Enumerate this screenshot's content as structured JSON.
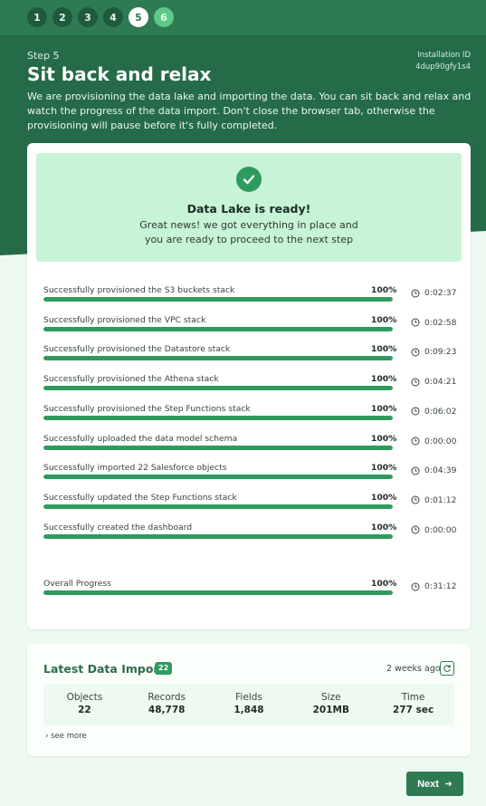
{
  "steps": [
    {
      "label": "1",
      "state": "done"
    },
    {
      "label": "2",
      "state": "done"
    },
    {
      "label": "3",
      "state": "done"
    },
    {
      "label": "4",
      "state": "done"
    },
    {
      "label": "5",
      "state": "active"
    },
    {
      "label": "6",
      "state": "future"
    }
  ],
  "header": {
    "step_label": "Step 5",
    "title": "Sit back and relax",
    "installation_label": "Installation ID",
    "installation_id": "4dup90gfy1s4",
    "description": "We are provisioning the data lake and importing the data. You can sit back and relax and watch the progress of the data import. Don't close the browser tab, otherwise the provisioning will pause before it's fully completed."
  },
  "ready": {
    "icon": "check-circle-icon",
    "title": "Data Lake is ready!",
    "text": "Great news! we got everything in place and you are ready to proceed to the next step"
  },
  "progress": [
    {
      "label": "Successfully provisioned the S3 buckets stack",
      "percent": "100%",
      "value": 1.0,
      "time": "0:02:37"
    },
    {
      "label": "Successfully provisioned the VPC stack",
      "percent": "100%",
      "value": 1.0,
      "time": "0:02:58"
    },
    {
      "label": "Successfully provisioned the Datastore stack",
      "percent": "100%",
      "value": 1.0,
      "time": "0:09:23"
    },
    {
      "label": "Successfully provisioned the Athena stack",
      "percent": "100%",
      "value": 1.0,
      "time": "0:04:21"
    },
    {
      "label": "Successfully provisioned the Step Functions stack",
      "percent": "100%",
      "value": 1.0,
      "time": "0:06:02"
    },
    {
      "label": "Successfully uploaded the data model schema",
      "percent": "100%",
      "value": 1.0,
      "time": "0:00:00"
    },
    {
      "label": "Successfully imported 22 Salesforce objects",
      "percent": "100%",
      "value": 1.0,
      "time": "0:04:39"
    },
    {
      "label": "Successfully updated the Step Functions stack",
      "percent": "100%",
      "value": 1.0,
      "time": "0:01:12"
    },
    {
      "label": "Successfully created the dashboard",
      "percent": "100%",
      "value": 1.0,
      "time": "0:00:00"
    }
  ],
  "overall": {
    "label": "Overall Progress",
    "percent": "100%",
    "value": 1.0,
    "time": "0:31:12"
  },
  "latest_import": {
    "title": "Latest Data Import",
    "badge": "22",
    "ago": "2 weeks ago",
    "stats": [
      {
        "label": "Objects",
        "value": "22"
      },
      {
        "label": "Records",
        "value": "48,778"
      },
      {
        "label": "Fields",
        "value": "1,848"
      },
      {
        "label": "Size",
        "value": "201MB"
      },
      {
        "label": "Time",
        "value": "277 sec"
      }
    ],
    "see_more": "see more"
  },
  "next_button": "Next",
  "colors": {
    "primary": "#2e7a52",
    "hero": "#256b48",
    "progress": "#2f9a5e",
    "ready_bg": "#c7f3d6"
  }
}
